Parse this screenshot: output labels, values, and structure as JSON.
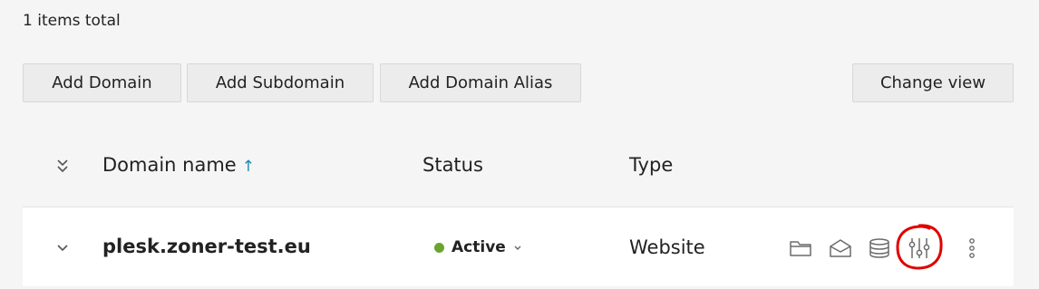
{
  "summary": {
    "total_label": "1 items total"
  },
  "toolbar": {
    "add_domain": "Add Domain",
    "add_subdomain": "Add Subdomain",
    "add_domain_alias": "Add Domain Alias",
    "change_view": "Change view"
  },
  "table": {
    "headers": {
      "domain_name": "Domain name",
      "status": "Status",
      "type": "Type"
    },
    "sort": {
      "column": "domain_name",
      "direction": "ascending",
      "indicator": "↑"
    },
    "rows": [
      {
        "domain": "plesk.zoner-test.eu",
        "status": "Active",
        "status_color": "#6aa52e",
        "type": "Website",
        "actions": [
          "folder-icon",
          "mail-icon",
          "database-icon",
          "settings-sliders-icon",
          "more-options-icon"
        ]
      }
    ]
  },
  "annotation": {
    "highlight_color": "#e00000",
    "highlighted_action": "settings-sliders-icon"
  }
}
